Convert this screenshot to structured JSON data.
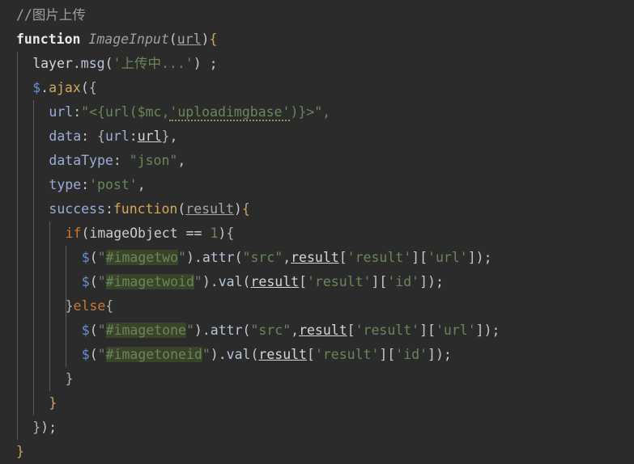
{
  "editor": {
    "background_color": "#2b2b2b",
    "default_text_color": "#a9b7c6",
    "selection_highlight_color": "#3a4429",
    "indent_guide_color": "#5a5a58",
    "language": "javascript"
  },
  "code": {
    "lines": [
      {
        "n": 1,
        "indent": 0,
        "text": "//图片上传",
        "tokens": [
          {
            "t": "//图片上传",
            "k": "comment"
          }
        ]
      },
      {
        "n": 2,
        "indent": 0,
        "text": "function ImageInput(url){",
        "tokens": [
          {
            "t": "function",
            "k": "keyword"
          },
          {
            "t": " ",
            "k": "plain"
          },
          {
            "t": "ImageInput",
            "k": "fnname"
          },
          {
            "t": "(",
            "k": "punc"
          },
          {
            "t": "url",
            "k": "param"
          },
          {
            "t": ")",
            "k": "punc"
          },
          {
            "t": "{",
            "k": "brace1"
          }
        ]
      },
      {
        "n": 3,
        "indent": 1,
        "text": "layer.msg('上传中...') ;",
        "tokens": [
          {
            "t": "layer",
            "k": "plain"
          },
          {
            "t": ".",
            "k": "punc"
          },
          {
            "t": "msg",
            "k": "method"
          },
          {
            "t": "(",
            "k": "punc"
          },
          {
            "t": "'上传中...'",
            "k": "string"
          },
          {
            "t": ")",
            "k": "punc"
          },
          {
            "t": " ;",
            "k": "punc"
          }
        ]
      },
      {
        "n": 4,
        "indent": 1,
        "text": "$.ajax({",
        "tokens": [
          {
            "t": "$",
            "k": "dollar"
          },
          {
            "t": ".",
            "k": "punc"
          },
          {
            "t": "ajax",
            "k": "func"
          },
          {
            "t": "(",
            "k": "punc"
          },
          {
            "t": "{",
            "k": "brace2"
          }
        ]
      },
      {
        "n": 5,
        "indent": 2,
        "text": "url:\"<{url($mc,'uploadimgbase')}>\",",
        "tokens": [
          {
            "t": "url",
            "k": "prop"
          },
          {
            "t": ":",
            "k": "punc"
          },
          {
            "t": "\"<{url($mc,",
            "k": "string"
          },
          {
            "t": "'uploadimgbase'",
            "k": "string-squiggly"
          },
          {
            "t": ")}>\",",
            "k": "string"
          }
        ]
      },
      {
        "n": 6,
        "indent": 2,
        "text": "data: {url:url},",
        "tokens": [
          {
            "t": "data",
            "k": "prop"
          },
          {
            "t": ": ",
            "k": "punc"
          },
          {
            "t": "{",
            "k": "brace2"
          },
          {
            "t": "url",
            "k": "prop"
          },
          {
            "t": ":",
            "k": "punc"
          },
          {
            "t": "url",
            "k": "var"
          },
          {
            "t": "}",
            "k": "brace2"
          },
          {
            "t": ",",
            "k": "punc"
          }
        ]
      },
      {
        "n": 7,
        "indent": 2,
        "text": "dataType: \"json\",",
        "tokens": [
          {
            "t": "dataType",
            "k": "prop"
          },
          {
            "t": ": ",
            "k": "punc"
          },
          {
            "t": "\"json\"",
            "k": "string"
          },
          {
            "t": ",",
            "k": "punc"
          }
        ]
      },
      {
        "n": 8,
        "indent": 2,
        "text": "type:'post',",
        "tokens": [
          {
            "t": "type",
            "k": "prop"
          },
          {
            "t": ":",
            "k": "punc"
          },
          {
            "t": "'post'",
            "k": "string"
          },
          {
            "t": ",",
            "k": "punc"
          }
        ]
      },
      {
        "n": 9,
        "indent": 2,
        "text": "success:function(result){",
        "tokens": [
          {
            "t": "success",
            "k": "prop"
          },
          {
            "t": ":",
            "k": "punc"
          },
          {
            "t": "function",
            "k": "func"
          },
          {
            "t": "(",
            "k": "punc"
          },
          {
            "t": "result",
            "k": "param"
          },
          {
            "t": ")",
            "k": "punc"
          },
          {
            "t": "{",
            "k": "brace1"
          }
        ]
      },
      {
        "n": 10,
        "indent": 3,
        "text": "if(imageObject == 1){",
        "tokens": [
          {
            "t": "if",
            "k": "ctrl"
          },
          {
            "t": "(",
            "k": "punc"
          },
          {
            "t": "imageObject",
            "k": "ident"
          },
          {
            "t": " ",
            "k": "plain"
          },
          {
            "t": "==",
            "k": "op"
          },
          {
            "t": " ",
            "k": "plain"
          },
          {
            "t": "1",
            "k": "num"
          },
          {
            "t": ")",
            "k": "punc"
          },
          {
            "t": "{",
            "k": "brace2"
          }
        ]
      },
      {
        "n": 11,
        "indent": 4,
        "text": "$(\"#imagetwo\").attr(\"src\",result['result']['url']);",
        "tokens": [
          {
            "t": "$",
            "k": "dollar"
          },
          {
            "t": "(",
            "k": "punc"
          },
          {
            "t": "\"",
            "k": "string"
          },
          {
            "t": "#imagetwo",
            "k": "string-highlight"
          },
          {
            "t": "\"",
            "k": "string"
          },
          {
            "t": ")",
            "k": "punc"
          },
          {
            "t": ".",
            "k": "punc"
          },
          {
            "t": "attr",
            "k": "method"
          },
          {
            "t": "(",
            "k": "punc"
          },
          {
            "t": "\"src\"",
            "k": "string"
          },
          {
            "t": ",",
            "k": "punc"
          },
          {
            "t": "result",
            "k": "var"
          },
          {
            "t": "[",
            "k": "punc"
          },
          {
            "t": "'result'",
            "k": "string"
          },
          {
            "t": "]",
            "k": "punc"
          },
          {
            "t": "[",
            "k": "punc"
          },
          {
            "t": "'url'",
            "k": "string"
          },
          {
            "t": "]",
            "k": "punc"
          },
          {
            "t": ")",
            "k": "punc"
          },
          {
            "t": ";",
            "k": "punc"
          }
        ]
      },
      {
        "n": 12,
        "indent": 4,
        "text": "$(\"#imagetwoid\").val(result['result']['id']);",
        "tokens": [
          {
            "t": "$",
            "k": "dollar"
          },
          {
            "t": "(",
            "k": "punc"
          },
          {
            "t": "\"",
            "k": "string"
          },
          {
            "t": "#imagetwoid",
            "k": "string-highlight"
          },
          {
            "t": "\"",
            "k": "string"
          },
          {
            "t": ")",
            "k": "punc"
          },
          {
            "t": ".",
            "k": "punc"
          },
          {
            "t": "val",
            "k": "method"
          },
          {
            "t": "(",
            "k": "punc"
          },
          {
            "t": "result",
            "k": "var"
          },
          {
            "t": "[",
            "k": "punc"
          },
          {
            "t": "'result'",
            "k": "string"
          },
          {
            "t": "]",
            "k": "punc"
          },
          {
            "t": "[",
            "k": "punc"
          },
          {
            "t": "'id'",
            "k": "string"
          },
          {
            "t": "]",
            "k": "punc"
          },
          {
            "t": ")",
            "k": "punc"
          },
          {
            "t": ";",
            "k": "punc"
          }
        ]
      },
      {
        "n": 13,
        "indent": 3,
        "text": "}else{",
        "tokens": [
          {
            "t": "}",
            "k": "brace2"
          },
          {
            "t": "else",
            "k": "ctrl"
          },
          {
            "t": "{",
            "k": "brace2"
          }
        ]
      },
      {
        "n": 14,
        "indent": 4,
        "text": "$(\"#imagetone\").attr(\"src\",result['result']['url']);",
        "tokens": [
          {
            "t": "$",
            "k": "dollar"
          },
          {
            "t": "(",
            "k": "punc"
          },
          {
            "t": "\"",
            "k": "string"
          },
          {
            "t": "#imagetone",
            "k": "string-highlight"
          },
          {
            "t": "\"",
            "k": "string"
          },
          {
            "t": ")",
            "k": "punc"
          },
          {
            "t": ".",
            "k": "punc"
          },
          {
            "t": "attr",
            "k": "method"
          },
          {
            "t": "(",
            "k": "punc"
          },
          {
            "t": "\"src\"",
            "k": "string"
          },
          {
            "t": ",",
            "k": "punc"
          },
          {
            "t": "result",
            "k": "var"
          },
          {
            "t": "[",
            "k": "punc"
          },
          {
            "t": "'result'",
            "k": "string"
          },
          {
            "t": "]",
            "k": "punc"
          },
          {
            "t": "[",
            "k": "punc"
          },
          {
            "t": "'url'",
            "k": "string"
          },
          {
            "t": "]",
            "k": "punc"
          },
          {
            "t": ")",
            "k": "punc"
          },
          {
            "t": ";",
            "k": "punc"
          }
        ]
      },
      {
        "n": 15,
        "indent": 4,
        "text": "$(\"#imagetoneid\").val(result['result']['id']);",
        "tokens": [
          {
            "t": "$",
            "k": "dollar"
          },
          {
            "t": "(",
            "k": "punc"
          },
          {
            "t": "\"",
            "k": "string"
          },
          {
            "t": "#imagetoneid",
            "k": "string-highlight"
          },
          {
            "t": "\"",
            "k": "string"
          },
          {
            "t": ")",
            "k": "punc"
          },
          {
            "t": ".",
            "k": "punc"
          },
          {
            "t": "val",
            "k": "method"
          },
          {
            "t": "(",
            "k": "punc"
          },
          {
            "t": "result",
            "k": "var"
          },
          {
            "t": "[",
            "k": "punc"
          },
          {
            "t": "'result'",
            "k": "string"
          },
          {
            "t": "]",
            "k": "punc"
          },
          {
            "t": "[",
            "k": "punc"
          },
          {
            "t": "'id'",
            "k": "string"
          },
          {
            "t": "]",
            "k": "punc"
          },
          {
            "t": ")",
            "k": "punc"
          },
          {
            "t": ";",
            "k": "punc"
          }
        ]
      },
      {
        "n": 16,
        "indent": 3,
        "text": "}",
        "tokens": [
          {
            "t": "}",
            "k": "brace2"
          }
        ]
      },
      {
        "n": 17,
        "indent": 2,
        "text": "}",
        "tokens": [
          {
            "t": "}",
            "k": "brace1"
          }
        ]
      },
      {
        "n": 18,
        "indent": 1,
        "text": "});",
        "tokens": [
          {
            "t": "}",
            "k": "brace2"
          },
          {
            "t": ")",
            "k": "punc"
          },
          {
            "t": ";",
            "k": "punc"
          }
        ]
      },
      {
        "n": 19,
        "indent": 0,
        "text": "}",
        "tokens": [
          {
            "t": "}",
            "k": "brace1"
          }
        ]
      }
    ]
  }
}
